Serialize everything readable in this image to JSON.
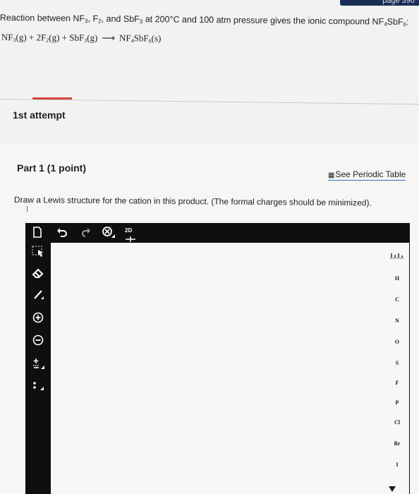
{
  "page_ref": "page 396",
  "problem": {
    "prefix": "Reaction between NF",
    "sub1": "3",
    "mid1": ", F",
    "sub2": "2",
    "mid2": ", and SbF",
    "sub3": "3",
    "mid3": " at 200°C and 100 atm pressure gives the ionic compound NF",
    "sub4": "4",
    "mid4": "SbF",
    "sub5": "6",
    "end": ":"
  },
  "equation": {
    "t1": "NF",
    "s1": "3",
    "t2": "(g) + 2F",
    "s2": "2",
    "t3": "(g) + SbF",
    "s3": "3",
    "t4": "(g)",
    "arrow": "⟶",
    "t5": "NF",
    "s5": "4",
    "t6": "SbF",
    "s6": "6",
    "t7": "(s)"
  },
  "attempt": "1st attempt",
  "part": {
    "title": "Part 1  (1 point)",
    "periodic_label": "See Periodic Table",
    "instruction": "Draw a Lewis structure for the cation in this product. (The formal charges should be minimized)."
  },
  "editor": {
    "toolbar": {
      "new_icon": "new-document-icon",
      "undo_icon": "undo-icon",
      "redo_icon": "redo-icon",
      "clear_icon": "clear-icon",
      "view_label": "2D"
    },
    "left_tools": [
      {
        "name": "select-icon",
        "glyph": "⬚"
      },
      {
        "name": "eraser-icon",
        "glyph": "◇"
      },
      {
        "name": "single-bond-icon",
        "glyph": "╱"
      },
      {
        "name": "add-charge-icon",
        "glyph": "⊕"
      },
      {
        "name": "remove-charge-icon",
        "glyph": "⊖"
      },
      {
        "name": "charge-template-icon",
        "glyph": "±"
      },
      {
        "name": "lone-pair-icon",
        "glyph": "⁚"
      }
    ],
    "elements": [
      "H",
      "C",
      "N",
      "O",
      "S",
      "F",
      "P",
      "Cl",
      "Br",
      "I"
    ]
  },
  "colors": {
    "accent_red": "#d8463b",
    "link_blue": "#2f6fbf",
    "toolbar_dark": "#0f0f0f"
  }
}
